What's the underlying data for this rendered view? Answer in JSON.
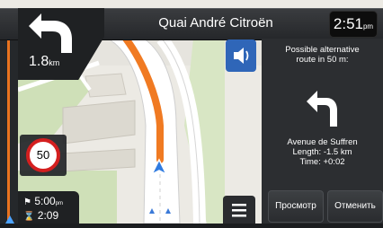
{
  "header": {
    "street_name": "Quai André Citroën",
    "clock_time": "2:51",
    "clock_suffix": "pm"
  },
  "next_turn": {
    "distance": "1.8",
    "unit": "km",
    "icon": "turn-left-arrow-icon"
  },
  "speed_limit": {
    "value": "50"
  },
  "alternative_panel": {
    "message_line1": "Possible alternative",
    "message_line2": "route in 50 m:",
    "turn_icon": "turn-left-arrow-icon",
    "street": "Avenue de Suffren",
    "length": "Length: -1.5 km",
    "time": "Time: +0:02",
    "view_button": "Просмотр",
    "cancel_button": "Отменить"
  },
  "trip": {
    "arrival_time": "5:00",
    "arrival_suffix": "pm",
    "remaining": "2:09"
  },
  "colors": {
    "route": "#f07a22",
    "speaker_button": "#2f66b8",
    "panel": "#2c2e31",
    "position_arrow": "#2f7be0"
  },
  "icons": {
    "speaker": "speaker-icon",
    "menu": "menu-icon",
    "finish_flag": "checkered-flag-icon",
    "position": "vehicle-position-icon"
  }
}
